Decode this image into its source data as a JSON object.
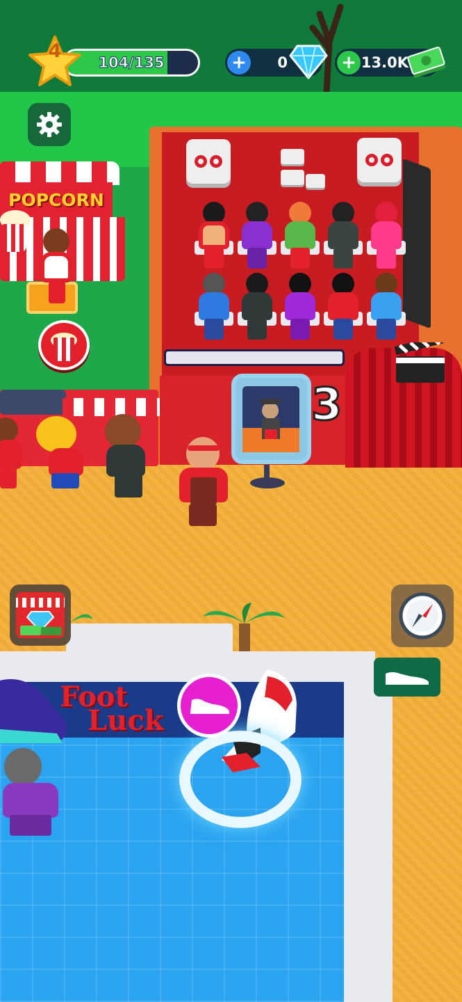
{
  "hud": {
    "level": "4",
    "xp_text": "104/135",
    "xp_progress": 0.77,
    "gems": "0",
    "cash": "13.0K"
  },
  "world": {
    "popcorn_sign": "POPCORN",
    "hall_number": "3",
    "store_sign_line1": "Foot",
    "store_sign_line2": "Luck"
  },
  "icons": {
    "settings": "gear-icon",
    "shop": "shop-icon",
    "compass": "compass-icon",
    "gem": "diamond-icon",
    "cash": "cash-icon",
    "popcorn": "popcorn-icon",
    "shoe": "sneaker-icon"
  },
  "colors": {
    "xp_fill": "#2dc84a",
    "gem_plus": "#2f8af0",
    "cash_plus": "#2dc84a",
    "shoe_badge": "#e61fd0"
  }
}
